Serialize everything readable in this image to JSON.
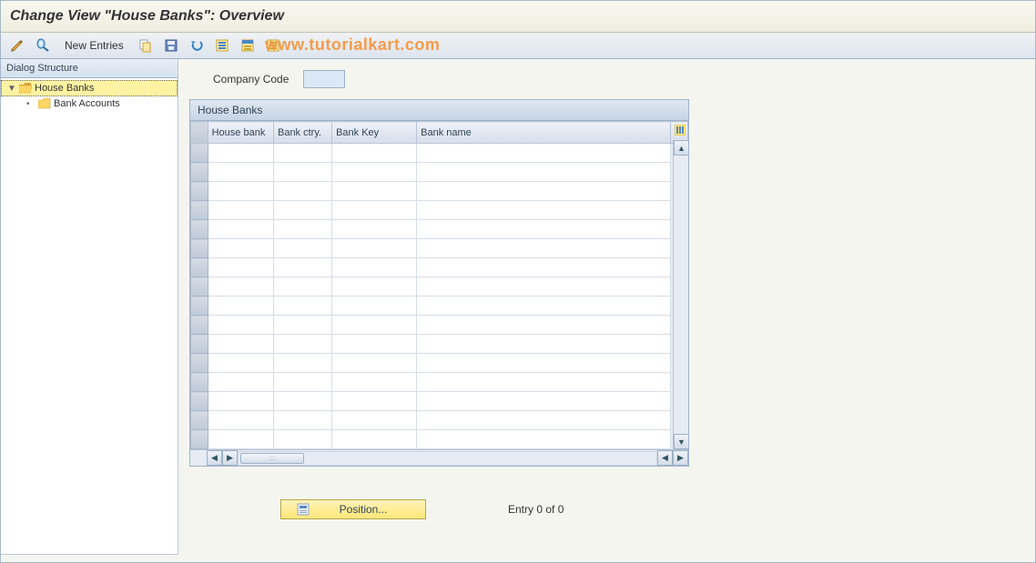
{
  "title": "Change View \"House Banks\": Overview",
  "watermark": "www.tutorialkart.com",
  "toolbar": {
    "new_entries_label": "New Entries"
  },
  "sidebar": {
    "header": "Dialog Structure",
    "items": [
      {
        "label": "House Banks",
        "selected": true,
        "level": 0,
        "expander": "▼",
        "folder": "open"
      },
      {
        "label": "Bank Accounts",
        "selected": false,
        "level": 1,
        "expander": "•",
        "folder": "closed"
      }
    ]
  },
  "field": {
    "company_code_label": "Company Code",
    "company_code_value": ""
  },
  "table": {
    "title": "House Banks",
    "columns": {
      "house_bank": "House bank",
      "bank_ctry": "Bank ctry.",
      "bank_key": "Bank Key",
      "bank_name": "Bank name"
    },
    "row_count": 16
  },
  "footer": {
    "position_label": "Position...",
    "entry_text": "Entry 0 of 0"
  }
}
